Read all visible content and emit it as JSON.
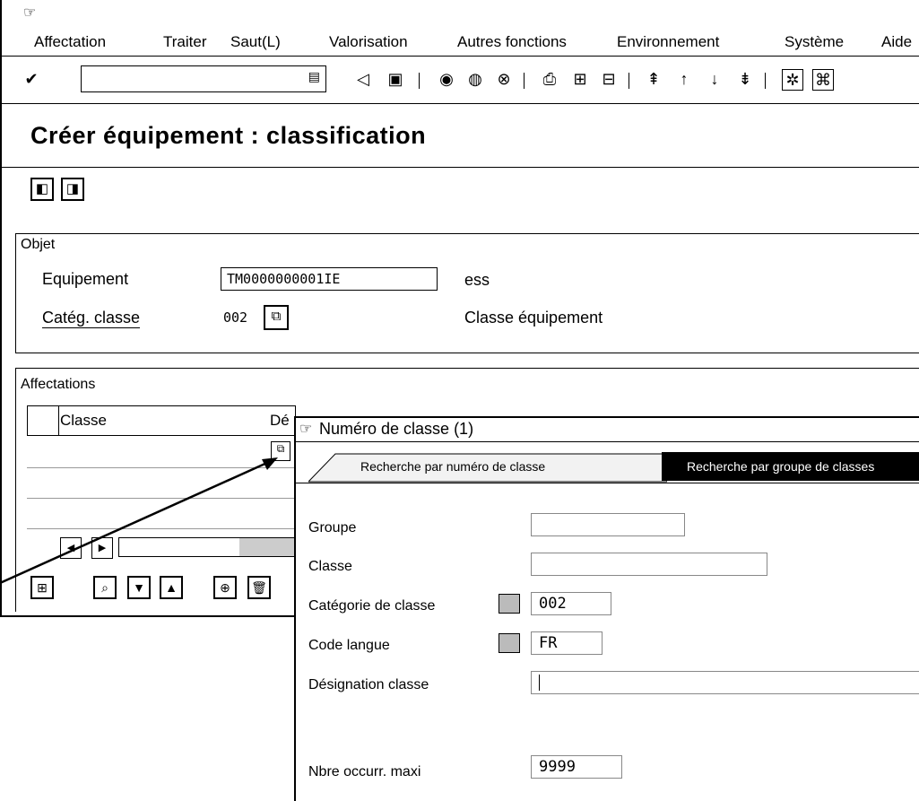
{
  "menubar": {
    "items": [
      "Affectation",
      "Traiter",
      "Saut(L)",
      "Valorisation",
      "Autres fonctions",
      "Environnement",
      "Système",
      "Aide"
    ]
  },
  "page": {
    "title": "Créer équipement : classification"
  },
  "objet": {
    "tab_label": "Objet",
    "equipement_label": "Equipement",
    "equipement_value": "TM0000000001IE",
    "equipement_desc": "ess",
    "categ_label": "Catég. classe",
    "categ_value": "002",
    "categ_desc": "Classe équipement"
  },
  "affectations": {
    "tab_label": "Affectations",
    "columns": [
      "Classe",
      "Dé"
    ]
  },
  "popup": {
    "title": "Numéro de classe (1)",
    "tabs": [
      "Recherche par numéro de classe",
      "Recherche par groupe de classes"
    ],
    "fields": {
      "groupe_label": "Groupe",
      "classe_label": "Classe",
      "categorie_label": "Catégorie de classe",
      "categorie_value": "002",
      "langue_label": "Code langue",
      "langue_value": "FR",
      "designation_label": "Désignation classe",
      "nbre_label": "Nbre occurr. maxi",
      "nbre_value": "9999"
    }
  }
}
